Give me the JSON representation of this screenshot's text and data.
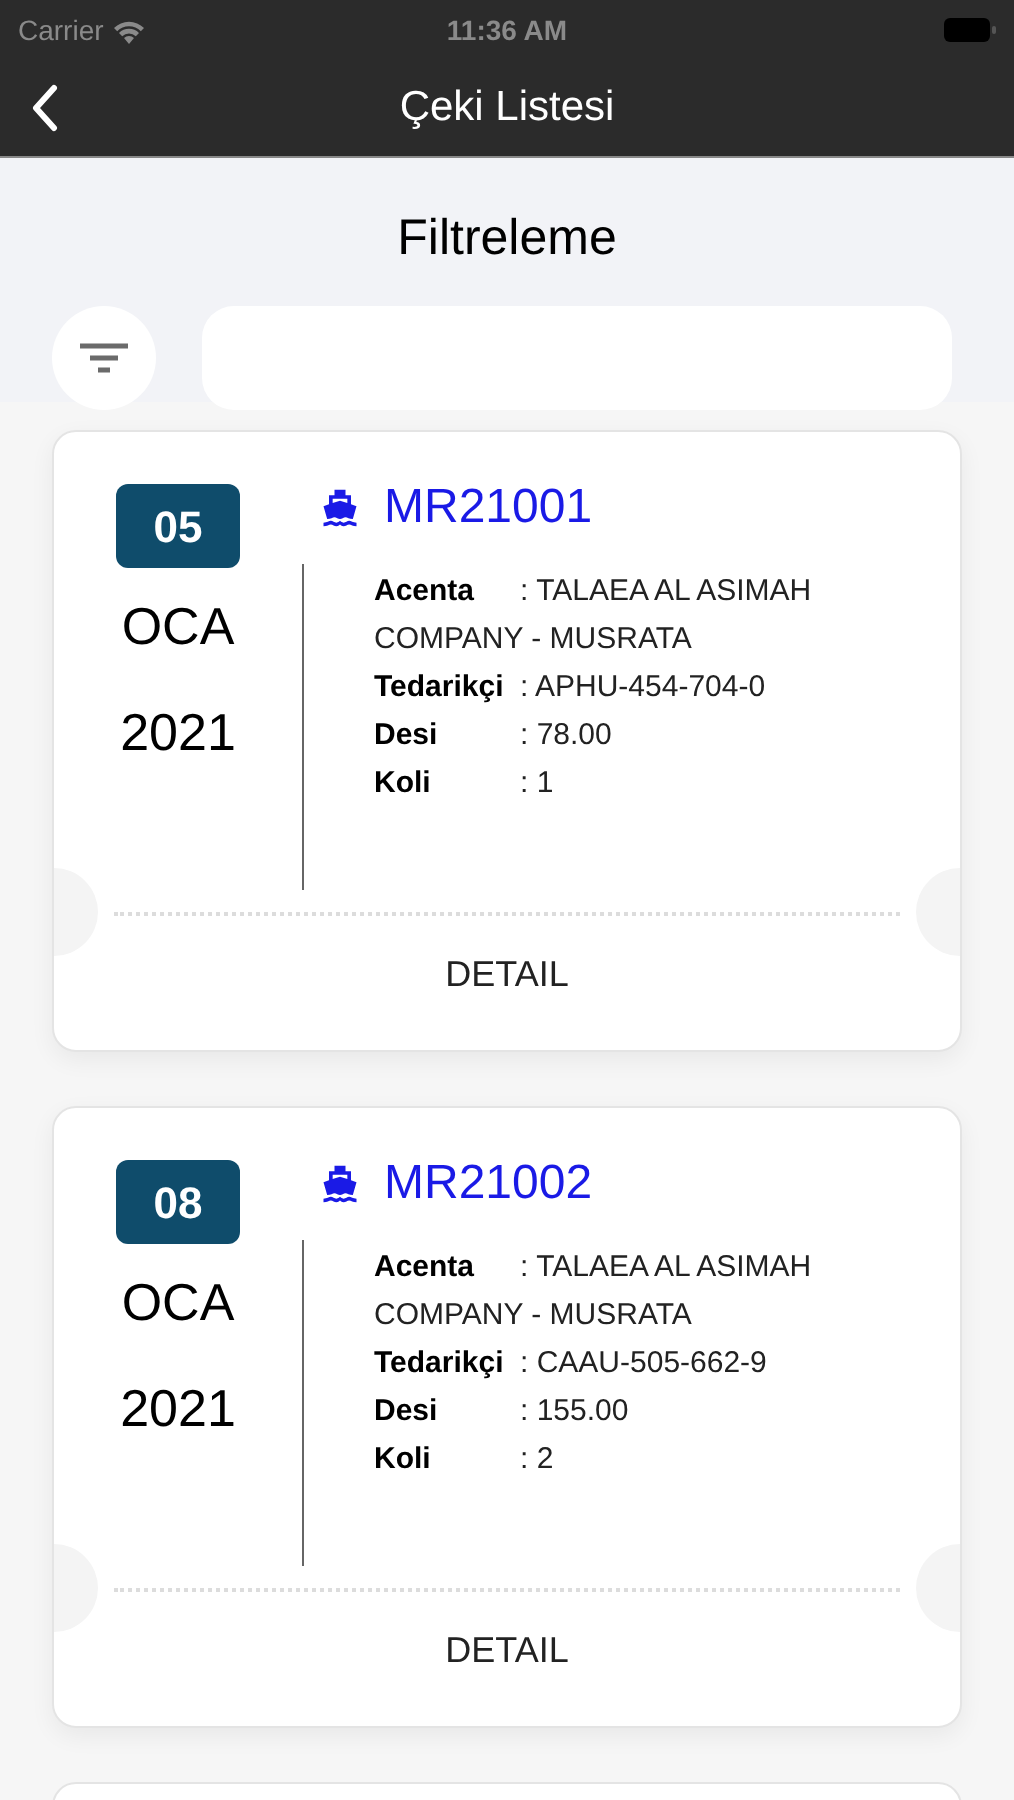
{
  "status_bar": {
    "carrier": "Carrier",
    "time": "11:36 AM"
  },
  "nav": {
    "title": "Çeki Listesi"
  },
  "filter": {
    "title": "Filtreleme"
  },
  "cards": [
    {
      "day": "05",
      "month": "OCA",
      "year": "2021",
      "code": "MR21001",
      "fields": [
        {
          "label": "Acenta",
          "value": ": TALAEA AL ASIMAH COMPANY - MUSRATA"
        },
        {
          "label": "Tedarikçi",
          "value": ": APHU-454-704-0"
        },
        {
          "label": "Desi",
          "value": ": 78.00"
        },
        {
          "label": "Koli",
          "value": ": 1"
        }
      ],
      "action": "DETAIL"
    },
    {
      "day": "08",
      "month": "OCA",
      "year": "2021",
      "code": "MR21002",
      "fields": [
        {
          "label": "Acenta",
          "value": ": TALAEA AL ASIMAH COMPANY - MUSRATA"
        },
        {
          "label": "Tedarikçi",
          "value": ": CAAU-505-662-9"
        },
        {
          "label": "Desi",
          "value": ": 155.00"
        },
        {
          "label": "Koli",
          "value": ": 2"
        }
      ],
      "action": "DETAIL"
    }
  ]
}
